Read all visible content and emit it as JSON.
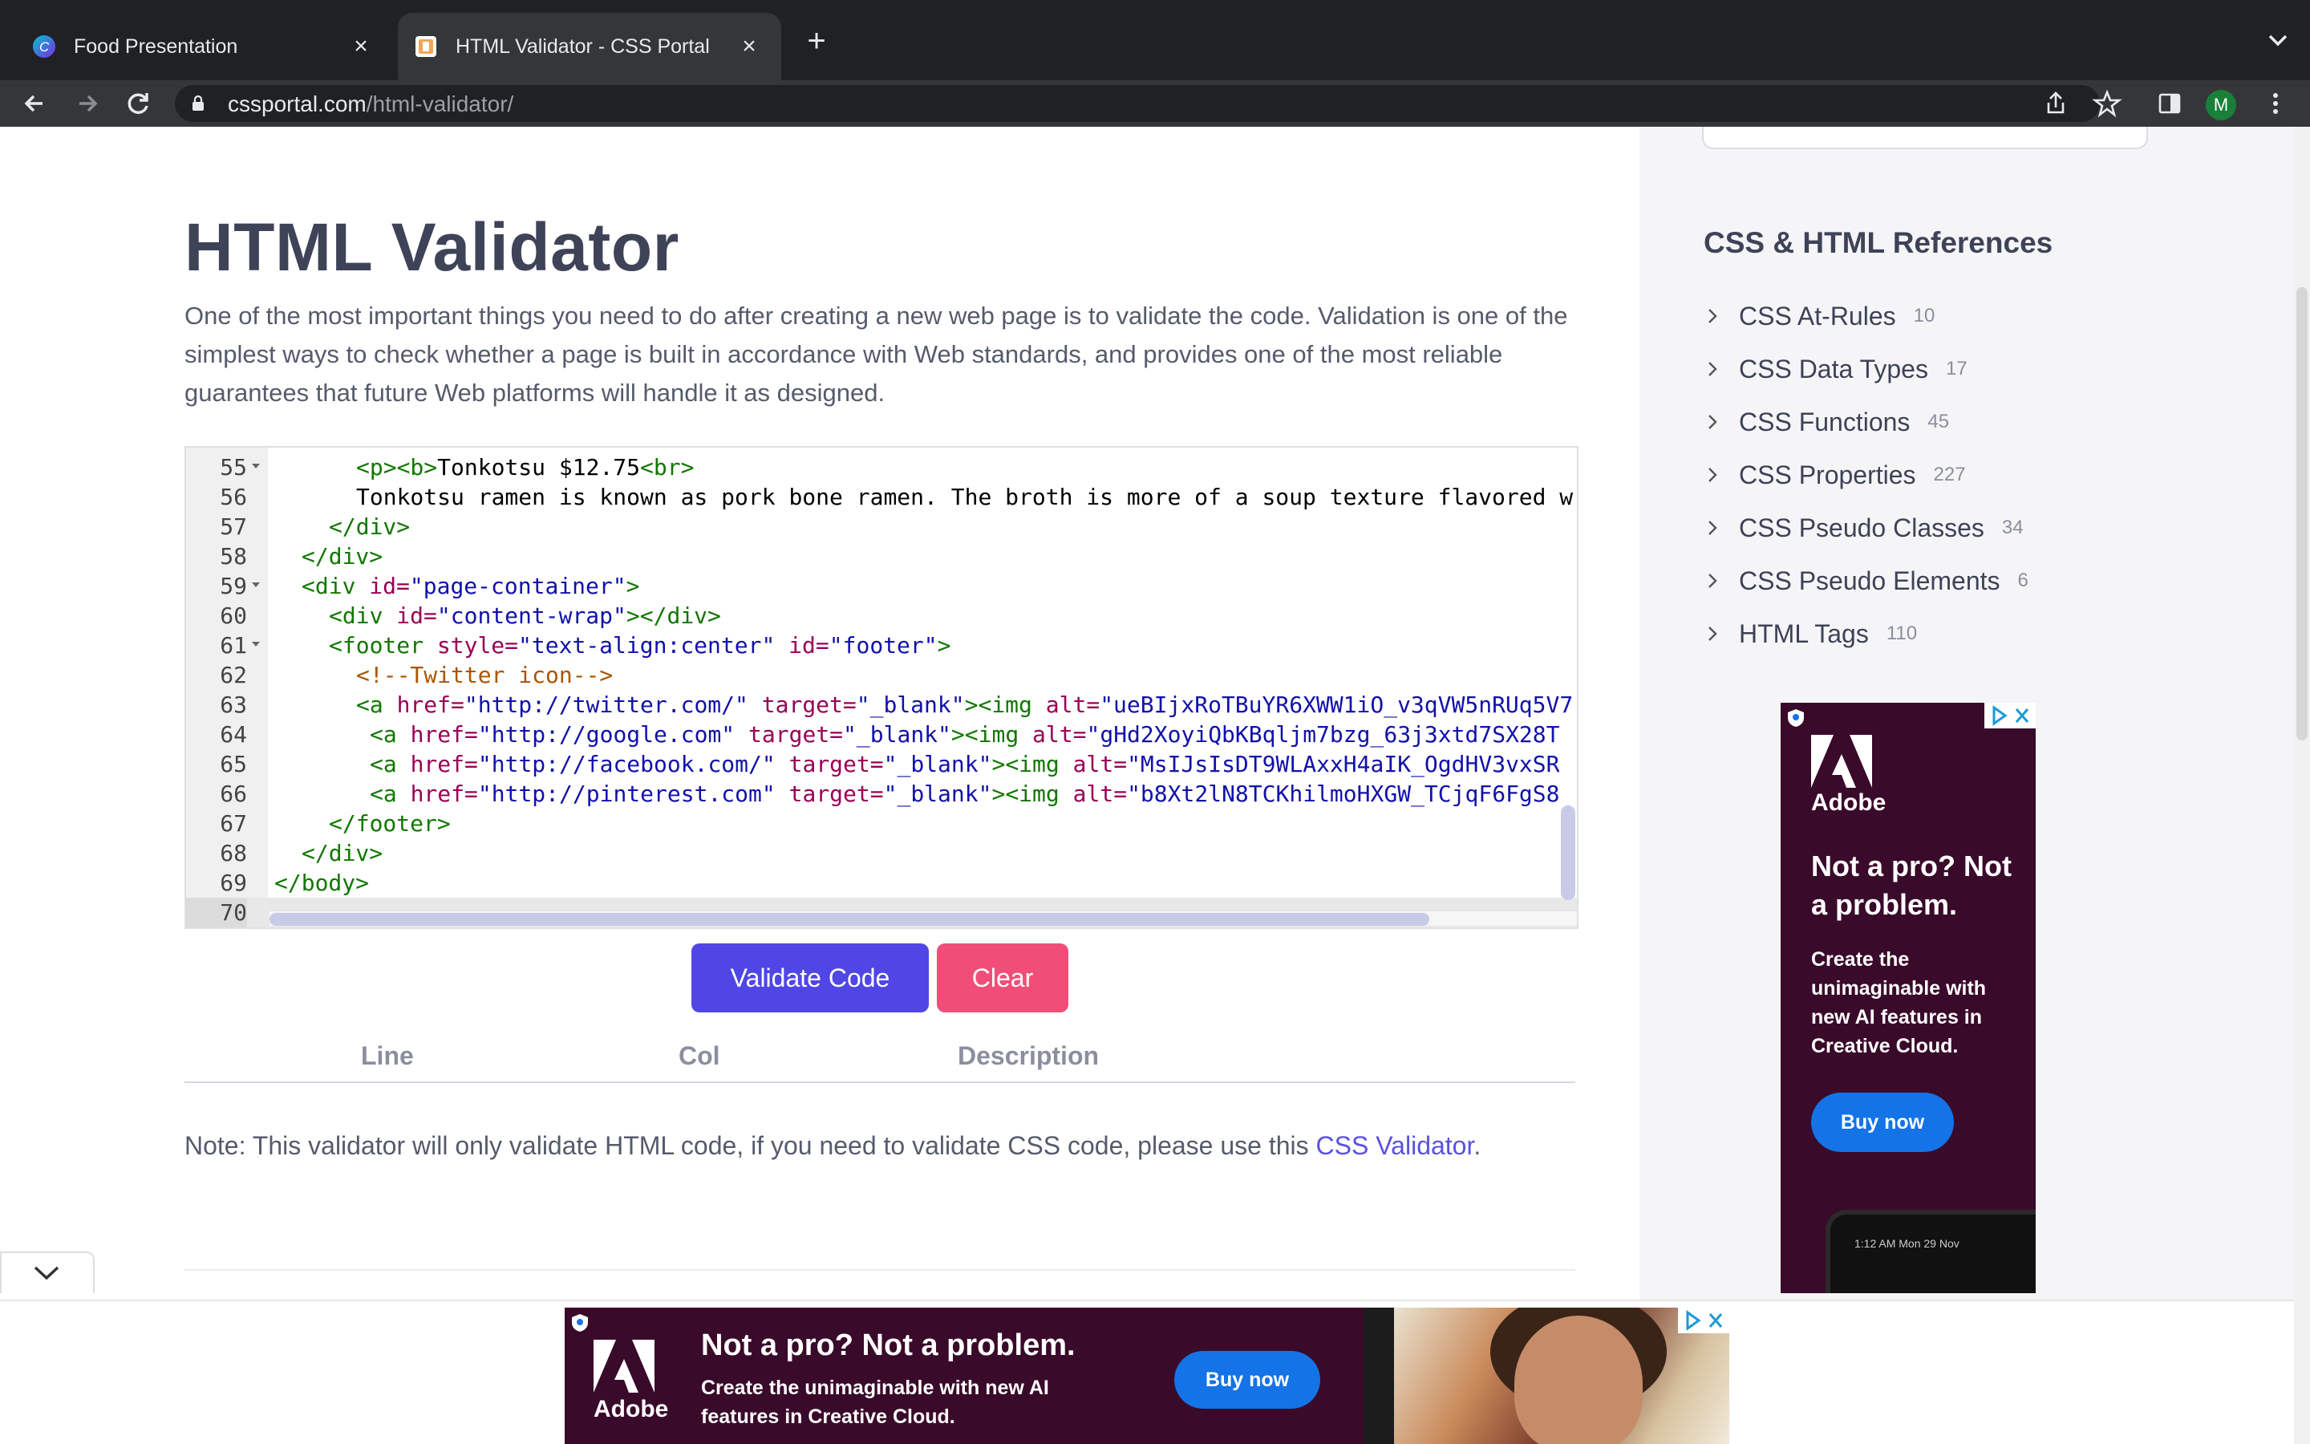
{
  "browser": {
    "tabs": [
      {
        "title": "Food Presentation",
        "active": false
      },
      {
        "title": "HTML Validator - CSS Portal",
        "active": true
      }
    ],
    "url_host": "cssportal.com",
    "url_path": "/html-validator/",
    "profile_initial": "M"
  },
  "page": {
    "title": "HTML Validator",
    "intro": "One of the most important things you need to do after creating a new web page is to validate the code. Validation is one of the simplest ways to check whether a page is built in accordance with Web standards, and provides one of the most reliable guarantees that future Web platforms will handle it as designed.",
    "editor": {
      "lines": [
        {
          "n": "55",
          "fold": true,
          "indent": 3,
          "code": "<p><b>Tonkotsu $12.75<br>"
        },
        {
          "n": "56",
          "fold": false,
          "indent": 3,
          "code": "Tonkotsu ramen is known as pork bone ramen. The broth is more of a soup texture flavored w"
        },
        {
          "n": "57",
          "fold": false,
          "indent": 2,
          "code": "</div>"
        },
        {
          "n": "58",
          "fold": false,
          "indent": 1,
          "code": "</div>"
        },
        {
          "n": "59",
          "fold": true,
          "indent": 1,
          "code": "<div id=\"page-container\">"
        },
        {
          "n": "60",
          "fold": false,
          "indent": 2,
          "code": "<div id=\"content-wrap\"></div>"
        },
        {
          "n": "61",
          "fold": true,
          "indent": 2,
          "code": "<footer style=\"text-align:center\" id=\"footer\">"
        },
        {
          "n": "62",
          "fold": false,
          "indent": 3,
          "code": "<!--Twitter icon-->"
        },
        {
          "n": "63",
          "fold": false,
          "indent": 3,
          "code": "<a href=\"http://twitter.com/\" target=\"_blank\"><img alt=\"ueBIjxRoTBuYR6XWW1iO_v3qVW5nRUq5V7"
        },
        {
          "n": "64",
          "fold": false,
          "indent": 3.5,
          "code": "<a href=\"http://google.com\" target=\"_blank\"><img alt=\"gHd2XoyiQbKBqljm7bzg_63j3xtd7SX28T"
        },
        {
          "n": "65",
          "fold": false,
          "indent": 3.5,
          "code": "<a href=\"http://facebook.com/\" target=\"_blank\"><img alt=\"MsIJsIsDT9WLAxxH4aIK_OgdHV3vxSR"
        },
        {
          "n": "66",
          "fold": false,
          "indent": 3.5,
          "code": "<a href=\"http://pinterest.com\" target=\"_blank\"><img alt=\"b8Xt2lN8TCKhilmoHXGW_TCjqF6FgS8"
        },
        {
          "n": "67",
          "fold": false,
          "indent": 2,
          "code": "</footer>"
        },
        {
          "n": "68",
          "fold": false,
          "indent": 1,
          "code": "</div>"
        },
        {
          "n": "69",
          "fold": false,
          "indent": 0,
          "code": "</body>"
        },
        {
          "n": "70",
          "fold": false,
          "indent": 0,
          "code": ""
        }
      ]
    },
    "validate_label": "Validate Code",
    "clear_label": "Clear",
    "results_columns": {
      "line": "Line",
      "col": "Col",
      "description": "Description"
    },
    "note_prefix": "Note: This validator will only validate HTML code, if you need to validate CSS code, please use this ",
    "note_link": "CSS Validator",
    "note_suffix": "."
  },
  "sidebar": {
    "title": "CSS & HTML References",
    "items": [
      {
        "label": "CSS At-Rules",
        "count": "10"
      },
      {
        "label": "CSS Data Types",
        "count": "17"
      },
      {
        "label": "CSS Functions",
        "count": "45"
      },
      {
        "label": "CSS Properties",
        "count": "227"
      },
      {
        "label": "CSS Pseudo Classes",
        "count": "34"
      },
      {
        "label": "CSS Pseudo Elements",
        "count": "6"
      },
      {
        "label": "HTML Tags",
        "count": "110"
      }
    ],
    "ad": {
      "brand": "Adobe",
      "headline": "Not a pro? Not a problem.",
      "body": "Create the unimaginable with new AI features in Creative Cloud.",
      "cta": "Buy now",
      "device_text": "1:12 AM   Mon 29 Nov"
    }
  },
  "bottom_ad": {
    "brand": "Adobe",
    "headline": "Not a pro? Not a problem.",
    "body": "Create the unimaginable with new AI features in Creative Cloud.",
    "cta": "Buy now"
  },
  "colors": {
    "validate_button": "#5046e5",
    "clear_button": "#f04e78",
    "ad_background": "#3a0a2a",
    "ad_cta": "#1473e6"
  }
}
